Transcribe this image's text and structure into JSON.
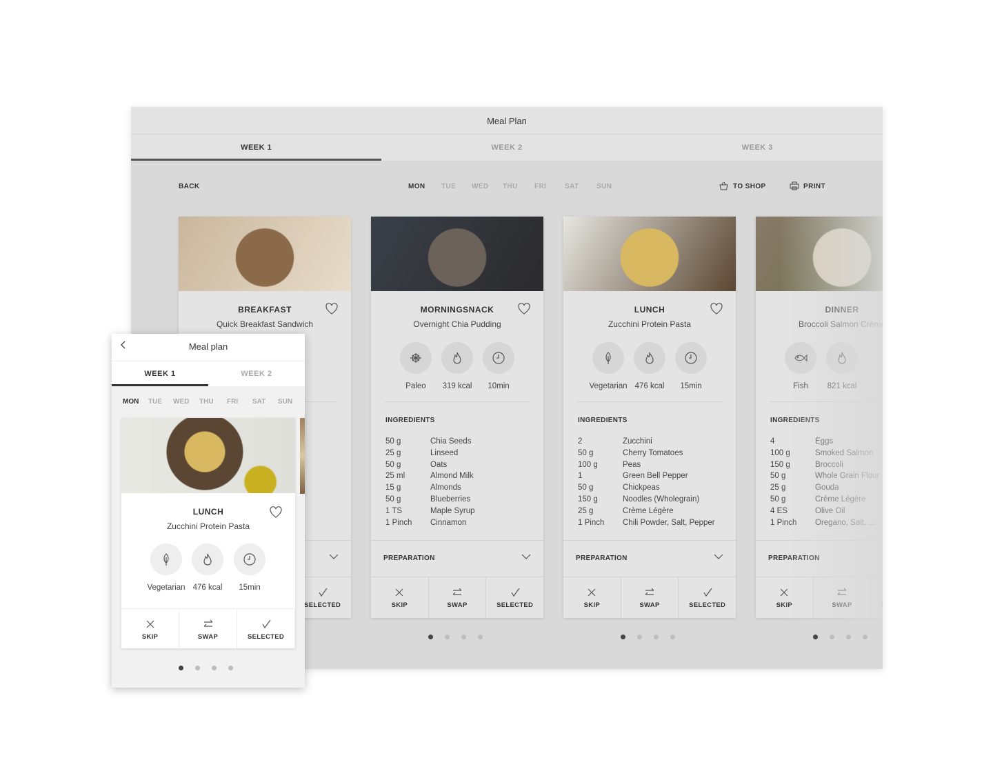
{
  "window": {
    "title": "Meal Plan",
    "tabs": [
      "WEEK 1",
      "WEEK 2",
      "WEEK 3"
    ],
    "active_tab": 0
  },
  "toolbar": {
    "back": "BACK",
    "days": [
      "MON",
      "TUE",
      "WED",
      "THU",
      "FRI",
      "SAT",
      "SUN"
    ],
    "active_day": 0,
    "to_shop": "TO SHOP",
    "print": "PRINT"
  },
  "labels": {
    "ingredients": "INGREDIENTS",
    "preparation": "PREPARATION",
    "skip": "SKIP",
    "swap": "SWAP",
    "selected": "SELECTED"
  },
  "cards": [
    {
      "meal": "BREAKFAST",
      "recipe": "Quick Breakfast Sandwich",
      "stats": [],
      "ingredients": [],
      "image_colors": [
        "#c9b79c",
        "#8a6a48",
        "#e8dccb"
      ]
    },
    {
      "meal": "MORNINGSNACK",
      "recipe": "Overnight Chia Pudding",
      "stats": [
        {
          "icon": "paleo-icon",
          "label": "Paleo"
        },
        {
          "icon": "flame-icon",
          "label": "319 kcal"
        },
        {
          "icon": "clock-icon",
          "label": "10min"
        }
      ],
      "ingredients": [
        [
          "50 g",
          "Chia Seeds"
        ],
        [
          "25 g",
          "Linseed"
        ],
        [
          "50 g",
          "Oats"
        ],
        [
          "25 ml",
          "Almond Milk"
        ],
        [
          "15 g",
          "Almonds"
        ],
        [
          "50 g",
          "Blueberries"
        ],
        [
          "1 TS",
          "Maple Syrup"
        ],
        [
          "1 Pinch",
          "Cinnamon"
        ]
      ],
      "image_colors": [
        "#3a4048",
        "#6b625a",
        "#2b2a2c"
      ]
    },
    {
      "meal": "LUNCH",
      "recipe": "Zucchini Protein Pasta",
      "stats": [
        {
          "icon": "leaf-icon",
          "label": "Vegetarian"
        },
        {
          "icon": "flame-icon",
          "label": "476 kcal"
        },
        {
          "icon": "clock-icon",
          "label": "15min"
        }
      ],
      "ingredients": [
        [
          "2",
          "Zucchini"
        ],
        [
          "50 g",
          "Cherry Tomatoes"
        ],
        [
          "100 g",
          "Peas"
        ],
        [
          "1",
          "Green Bell Pepper"
        ],
        [
          "50 g",
          "Chickpeas"
        ],
        [
          "150 g",
          "Noodles (Wholegrain)"
        ],
        [
          "25 g",
          "Crème Légère"
        ],
        [
          "1 Pinch",
          "Chili Powder, Salt, Pepper"
        ]
      ],
      "image_colors": [
        "#e6e6e0",
        "#d8b860",
        "#5a4632"
      ]
    },
    {
      "meal": "DINNER",
      "recipe": "Broccoli Salmon Crème",
      "stats": [
        {
          "icon": "fish-icon",
          "label": "Fish"
        },
        {
          "icon": "flame-icon",
          "label": "821 kcal"
        }
      ],
      "ingredients": [
        [
          "4",
          "Eggs"
        ],
        [
          "100 g",
          "Smoked Salmon"
        ],
        [
          "150 g",
          "Broccoli"
        ],
        [
          "50 g",
          "Whole Grain Flour"
        ],
        [
          "25 g",
          "Gouda"
        ],
        [
          "50 g",
          "Crème Légère"
        ],
        [
          "4 ES",
          "Olive Oil"
        ],
        [
          "1 Pinch",
          "Oregano, Salt, ..."
        ]
      ],
      "image_colors": [
        "#8a7a6a",
        "#d8cdb8",
        "#5c6a3c"
      ]
    }
  ],
  "mobile": {
    "title": "Meal plan",
    "tabs": [
      "WEEK 1",
      "WEEK 2"
    ],
    "days": [
      "MON",
      "TUE",
      "WED",
      "THU",
      "FRI",
      "SAT",
      "SUN"
    ],
    "card": {
      "meal": "LUNCH",
      "recipe": "Zucchini Protein Pasta",
      "stats": [
        {
          "icon": "leaf-icon",
          "label": "Vegetarian"
        },
        {
          "icon": "flame-icon",
          "label": "476 kcal"
        },
        {
          "icon": "clock-icon",
          "label": "15min"
        }
      ]
    }
  }
}
